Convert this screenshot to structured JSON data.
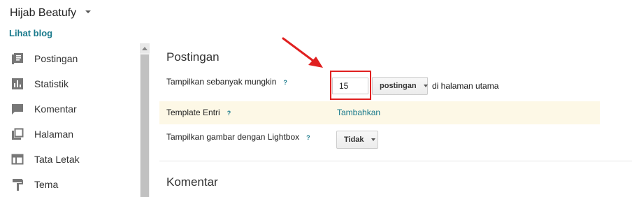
{
  "header": {
    "blog_title": "Hijab Beatufy",
    "view_blog": "Lihat blog"
  },
  "sidebar": {
    "items": [
      {
        "label": "Postingan",
        "icon": "posts-icon"
      },
      {
        "label": "Statistik",
        "icon": "stats-icon"
      },
      {
        "label": "Komentar",
        "icon": "comments-icon"
      },
      {
        "label": "Halaman",
        "icon": "pages-icon"
      },
      {
        "label": "Tata Letak",
        "icon": "layout-icon"
      },
      {
        "label": "Tema",
        "icon": "theme-icon"
      }
    ]
  },
  "posts_section": {
    "title": "Postingan",
    "show_max": {
      "label": "Tampilkan sebanyak mungkin",
      "help": "?",
      "value": "15",
      "unit_option": "postingan",
      "suffix": "di halaman utama"
    },
    "template": {
      "label": "Template Entri",
      "help": "?",
      "link": "Tambahkan"
    },
    "lightbox": {
      "label": "Tampilkan gambar dengan Lightbox",
      "help": "?",
      "value": "Tidak"
    }
  },
  "comments_section": {
    "title": "Komentar"
  },
  "colors": {
    "accent": "#1a7a8c",
    "highlight_row": "#fdf8e6",
    "annotation": "#e02020"
  }
}
